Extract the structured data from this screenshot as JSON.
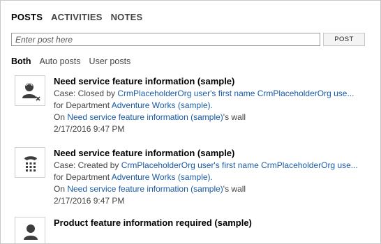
{
  "tabs": [
    "POSTS",
    "ACTIVITIES",
    "NOTES"
  ],
  "post_input": {
    "placeholder": "Enter post here",
    "value": ""
  },
  "post_button": "POST",
  "filters": [
    "Both",
    "Auto posts",
    "User posts"
  ],
  "posts": [
    {
      "icon": "user-closed-icon",
      "title": "Need service feature information (sample)",
      "line1_prefix": "Case: Closed by ",
      "line1_link": "CrmPlaceholderOrg user's first name CrmPlaceholderOrg use...",
      "line2_prefix": "for Department ",
      "line2_link": "Adventure Works (sample).",
      "line3_prefix": "On ",
      "line3_link": "Need service feature information (sample)",
      "line3_suffix": "'s wall",
      "timestamp": "2/17/2016 9:47 PM"
    },
    {
      "icon": "phone-keypad-icon",
      "title": "Need service feature information (sample)",
      "line1_prefix": "Case: Created by ",
      "line1_link": "CrmPlaceholderOrg user's first name CrmPlaceholderOrg use...",
      "line2_prefix": "for Department ",
      "line2_link": "Adventure Works (sample).",
      "line3_prefix": "On ",
      "line3_link": "Need service feature information (sample)",
      "line3_suffix": "'s wall",
      "timestamp": "2/17/2016 9:47 PM"
    },
    {
      "icon": "user-icon",
      "title": "Product feature information required (sample)"
    }
  ]
}
